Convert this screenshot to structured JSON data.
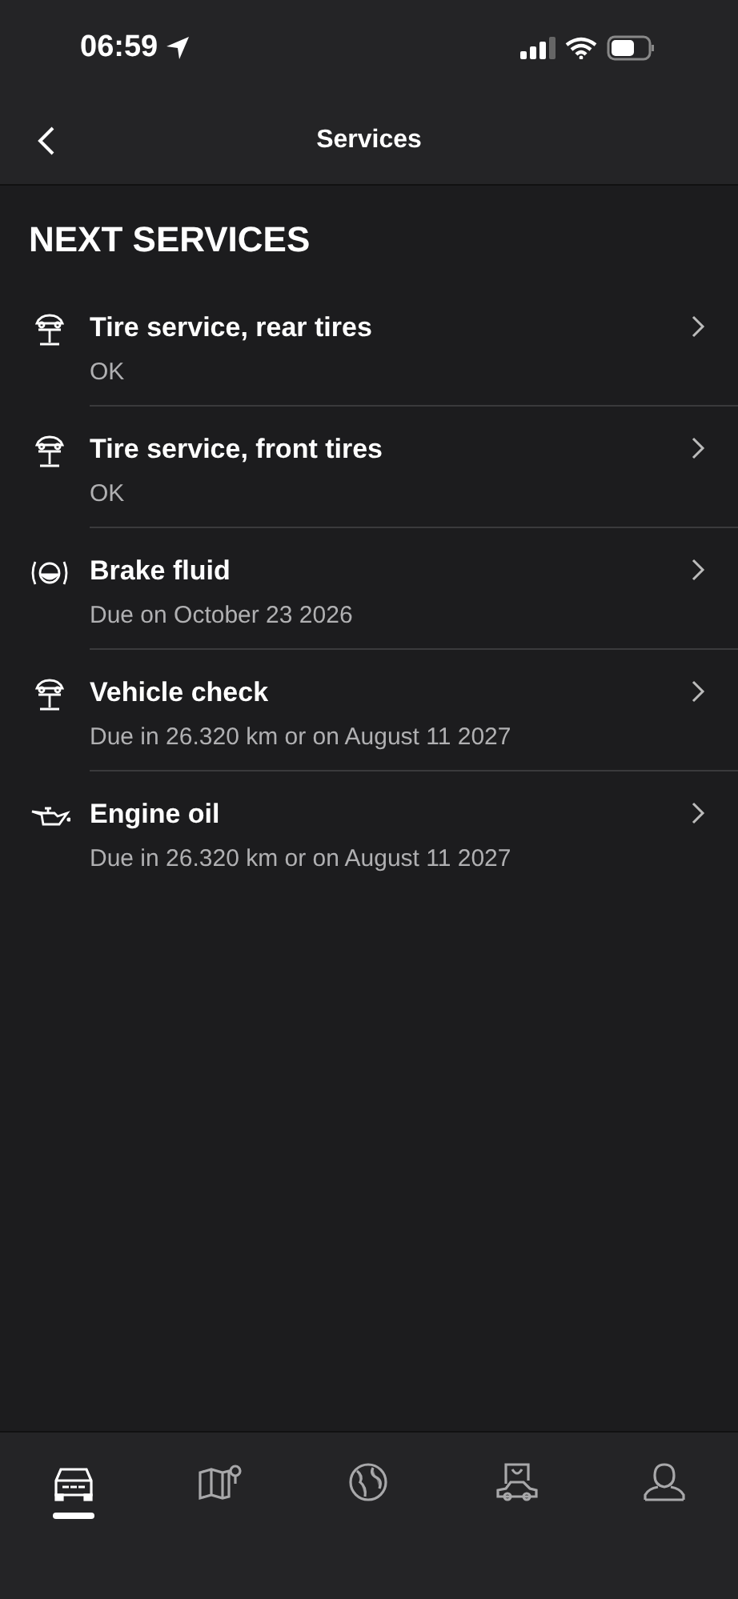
{
  "status_bar": {
    "time": "06:59"
  },
  "header": {
    "title": "Services"
  },
  "section": {
    "title": "NEXT SERVICES"
  },
  "services": [
    {
      "kind": "lift",
      "title": "Tire service, rear tires",
      "status": "OK"
    },
    {
      "kind": "lift",
      "title": "Tire service, front tires",
      "status": "OK"
    },
    {
      "kind": "brake",
      "title": "Brake fluid",
      "status": "Due on October 23 2026"
    },
    {
      "kind": "lift",
      "title": "Vehicle check",
      "status": "Due in 26.320 km or on August 11 2027"
    },
    {
      "kind": "oil",
      "title": "Engine oil",
      "status": "Due in 26.320 km or on August 11 2027"
    }
  ],
  "tab_bar": [
    {
      "kind": "car",
      "selected": true
    },
    {
      "kind": "map",
      "selected": false
    },
    {
      "kind": "globe",
      "selected": false
    },
    {
      "kind": "shop",
      "selected": false
    },
    {
      "kind": "profile",
      "selected": false
    }
  ]
}
